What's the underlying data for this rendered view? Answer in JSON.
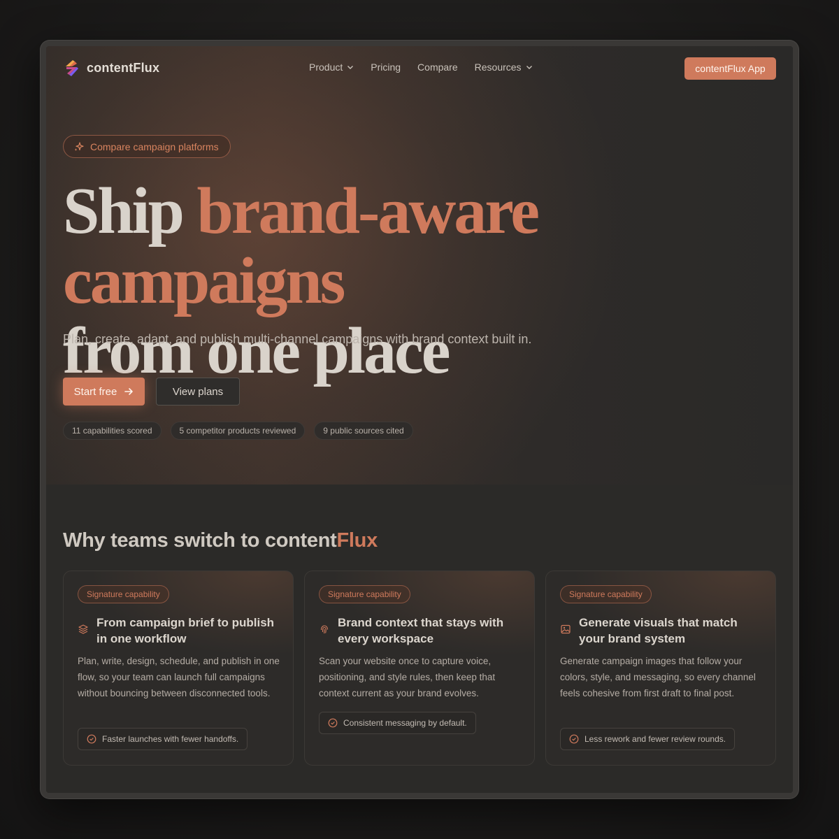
{
  "brand": {
    "name": "contentFlux",
    "accent": "#cf7a5c"
  },
  "nav": {
    "items": [
      {
        "label": "Product",
        "has_dropdown": true
      },
      {
        "label": "Pricing",
        "has_dropdown": false
      },
      {
        "label": "Compare",
        "has_dropdown": false
      },
      {
        "label": "Resources",
        "has_dropdown": true
      }
    ],
    "cta_label": "contentFlux App"
  },
  "hero": {
    "badge_label": "Compare campaign platforms",
    "headline_lead": "Ship ",
    "headline_accent": "brand-aware campaigns",
    "headline_tail": "from one place",
    "subheadline": "Plan, create, adapt, and publish multi-channel campaigns with brand context built in.",
    "primary_cta": "Start free",
    "secondary_cta": "View plans",
    "stats": [
      "11 capabilities scored",
      "5 competitor products reviewed",
      "9 public sources cited"
    ]
  },
  "features": {
    "title_lead": "Why teams switch to content",
    "title_accent": "Flux",
    "cards": [
      {
        "badge": "Signature capability",
        "icon": "layers-icon",
        "title": "From campaign brief to publish in one workflow",
        "body": "Plan, write, design, schedule, and publish in one flow, so your team can launch full campaigns without bouncing between disconnected tools.",
        "chip": "Faster launches with fewer handoffs."
      },
      {
        "badge": "Signature capability",
        "icon": "fingerprint-icon",
        "title": "Brand context that stays with every workspace",
        "body": "Scan your website once to capture voice, positioning, and style rules, then keep that context current as your brand evolves.",
        "chip": "Consistent messaging by default."
      },
      {
        "badge": "Signature capability",
        "icon": "image-icon",
        "title": "Generate visuals that match your brand system",
        "body": "Generate campaign images that follow your colors, style, and messaging, so every channel feels cohesive from first draft to final post.",
        "chip": "Less rework and fewer review rounds."
      }
    ]
  }
}
